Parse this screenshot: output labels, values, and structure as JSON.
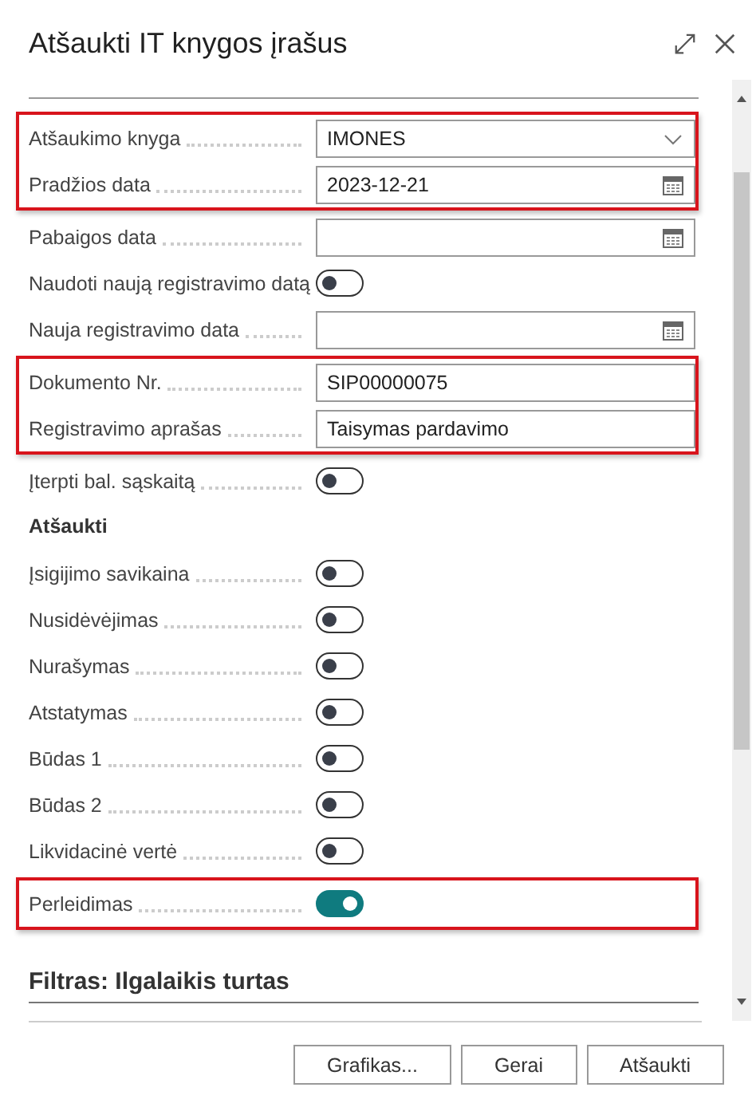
{
  "window": {
    "title": "Atšaukti IT knygos įrašus"
  },
  "groups": [
    {
      "highlighted": true,
      "rows": [
        {
          "kind": "dropdown",
          "label": "Atšaukimo knyga",
          "value": "IMONES"
        },
        {
          "kind": "date",
          "label": "Pradžios data",
          "value": "2023-12-21"
        }
      ]
    },
    {
      "highlighted": false,
      "rows": [
        {
          "kind": "date",
          "label": "Pabaigos data"
        },
        {
          "kind": "toggle",
          "label": "Naudoti naują registravimo datą",
          "on": false
        },
        {
          "kind": "date",
          "label": "Nauja registravimo data"
        }
      ]
    },
    {
      "highlighted": true,
      "rows": [
        {
          "kind": "text",
          "label": "Dokumento Nr.",
          "value": "SIP00000075"
        },
        {
          "kind": "text",
          "label": "Registravimo aprašas",
          "value": "Taisymas pardavimo"
        }
      ]
    },
    {
      "highlighted": false,
      "rows": [
        {
          "kind": "toggle",
          "label": "Įterpti bal. sąskaitą",
          "on": false
        },
        {
          "kind": "heading",
          "label": "Atšaukti"
        },
        {
          "kind": "toggle",
          "label": "Įsigijimo savikaina",
          "on": false
        },
        {
          "kind": "toggle",
          "label": "Nusidėvėjimas",
          "on": false
        },
        {
          "kind": "toggle",
          "label": "Nurašymas",
          "on": false
        },
        {
          "kind": "toggle",
          "label": "Atstatymas",
          "on": false
        },
        {
          "kind": "toggle",
          "label": "Būdas 1",
          "on": false
        },
        {
          "kind": "toggle",
          "label": "Būdas 2",
          "on": false
        },
        {
          "kind": "toggle",
          "label": "Likvidacinė vertė",
          "on": false
        }
      ]
    },
    {
      "highlighted": true,
      "rows": [
        {
          "kind": "toggle",
          "label": "Perleidimas",
          "on": true
        }
      ]
    }
  ],
  "filter_section": {
    "title": "Filtras: Ilgalaikis turtas"
  },
  "buttons": [
    "Grafikas...",
    "Gerai",
    "Atšaukti"
  ]
}
